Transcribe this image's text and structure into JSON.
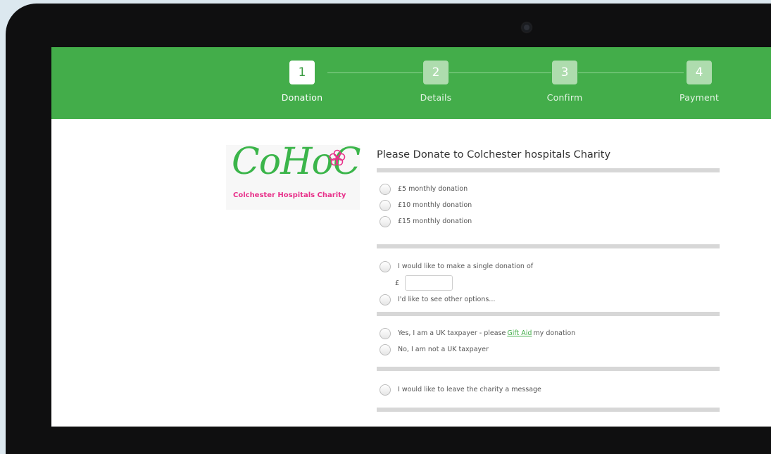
{
  "steps": [
    {
      "num": "1",
      "label": "Donation",
      "active": true
    },
    {
      "num": "2",
      "label": "Details",
      "active": false
    },
    {
      "num": "3",
      "label": "Confirm",
      "active": false
    },
    {
      "num": "4",
      "label": "Payment",
      "active": false
    }
  ],
  "logo": {
    "wordmark": "CoHoC",
    "subtitle": "Colchester Hospitals Charity"
  },
  "form": {
    "title": "Please Donate to Colchester hospitals Charity",
    "monthly": [
      "£5 monthly donation",
      "£10 monthly donation",
      "£15 monthly donation"
    ],
    "single_label": "I would like to make a single donation of",
    "currency_symbol": "£",
    "single_amount_value": "",
    "other_options": "I'd like to see other options...",
    "giftaid_yes_prefix": "Yes, I am a UK taxpayer - please",
    "giftaid_link": "Gift Aid",
    "giftaid_yes_suffix": "my donation",
    "giftaid_no": "No, I am not a UK taxpayer",
    "message_option": "I would like to leave the charity a message"
  },
  "colors": {
    "brand_green": "#43ad4a",
    "accent_pink": "#e8318a",
    "device": "#0f0f10"
  }
}
